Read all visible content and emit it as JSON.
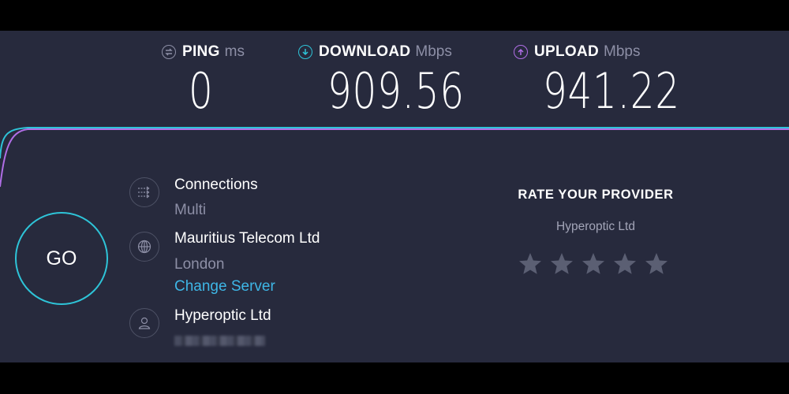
{
  "metrics": {
    "ping": {
      "label": "PING",
      "unit": "ms",
      "value": "0",
      "icon": "ping-icon"
    },
    "download": {
      "label": "DOWNLOAD",
      "unit": "Mbps",
      "value": "909.56",
      "icon": "download-arrow-icon",
      "color": "#2ec4d8"
    },
    "upload": {
      "label": "UPLOAD",
      "unit": "Mbps",
      "value": "941.22",
      "icon": "upload-arrow-icon",
      "color": "#b06ee6"
    }
  },
  "go_label": "GO",
  "connections": {
    "title": "Connections",
    "value": "Multi",
    "icon": "connections-icon"
  },
  "server": {
    "name": "Mauritius Telecom Ltd",
    "location": "London",
    "change_label": "Change Server",
    "icon": "globe-icon"
  },
  "provider": {
    "name": "Hyperoptic Ltd",
    "icon": "user-icon"
  },
  "rate": {
    "title": "RATE YOUR PROVIDER",
    "provider": "Hyperoptic Ltd",
    "rating": 0,
    "max": 5
  },
  "colors": {
    "background": "#272a3d",
    "accent": "#2ec4d8",
    "upload": "#b06ee6",
    "link": "#3eb6e6",
    "star": "#5b5f73"
  }
}
